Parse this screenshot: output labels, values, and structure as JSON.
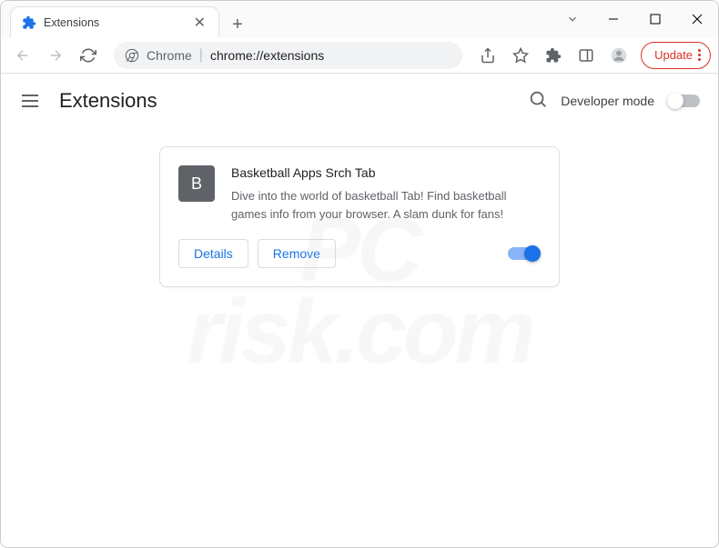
{
  "window": {
    "tab_title": "Extensions",
    "minimize": "—",
    "maximize": "",
    "close": ""
  },
  "toolbar": {
    "address_scheme": "Chrome",
    "address_path": "chrome://extensions",
    "update_label": "Update"
  },
  "page": {
    "title": "Extensions",
    "dev_mode_label": "Developer mode"
  },
  "extension": {
    "icon_letter": "B",
    "name": "Basketball Apps Srch Tab",
    "description": "Dive into the world of basketball Tab! Find basketball games info from your browser. A slam dunk for fans!",
    "details_label": "Details",
    "remove_label": "Remove",
    "enabled": true
  },
  "watermark": {
    "line1": "PC",
    "line2": "risk.com"
  }
}
